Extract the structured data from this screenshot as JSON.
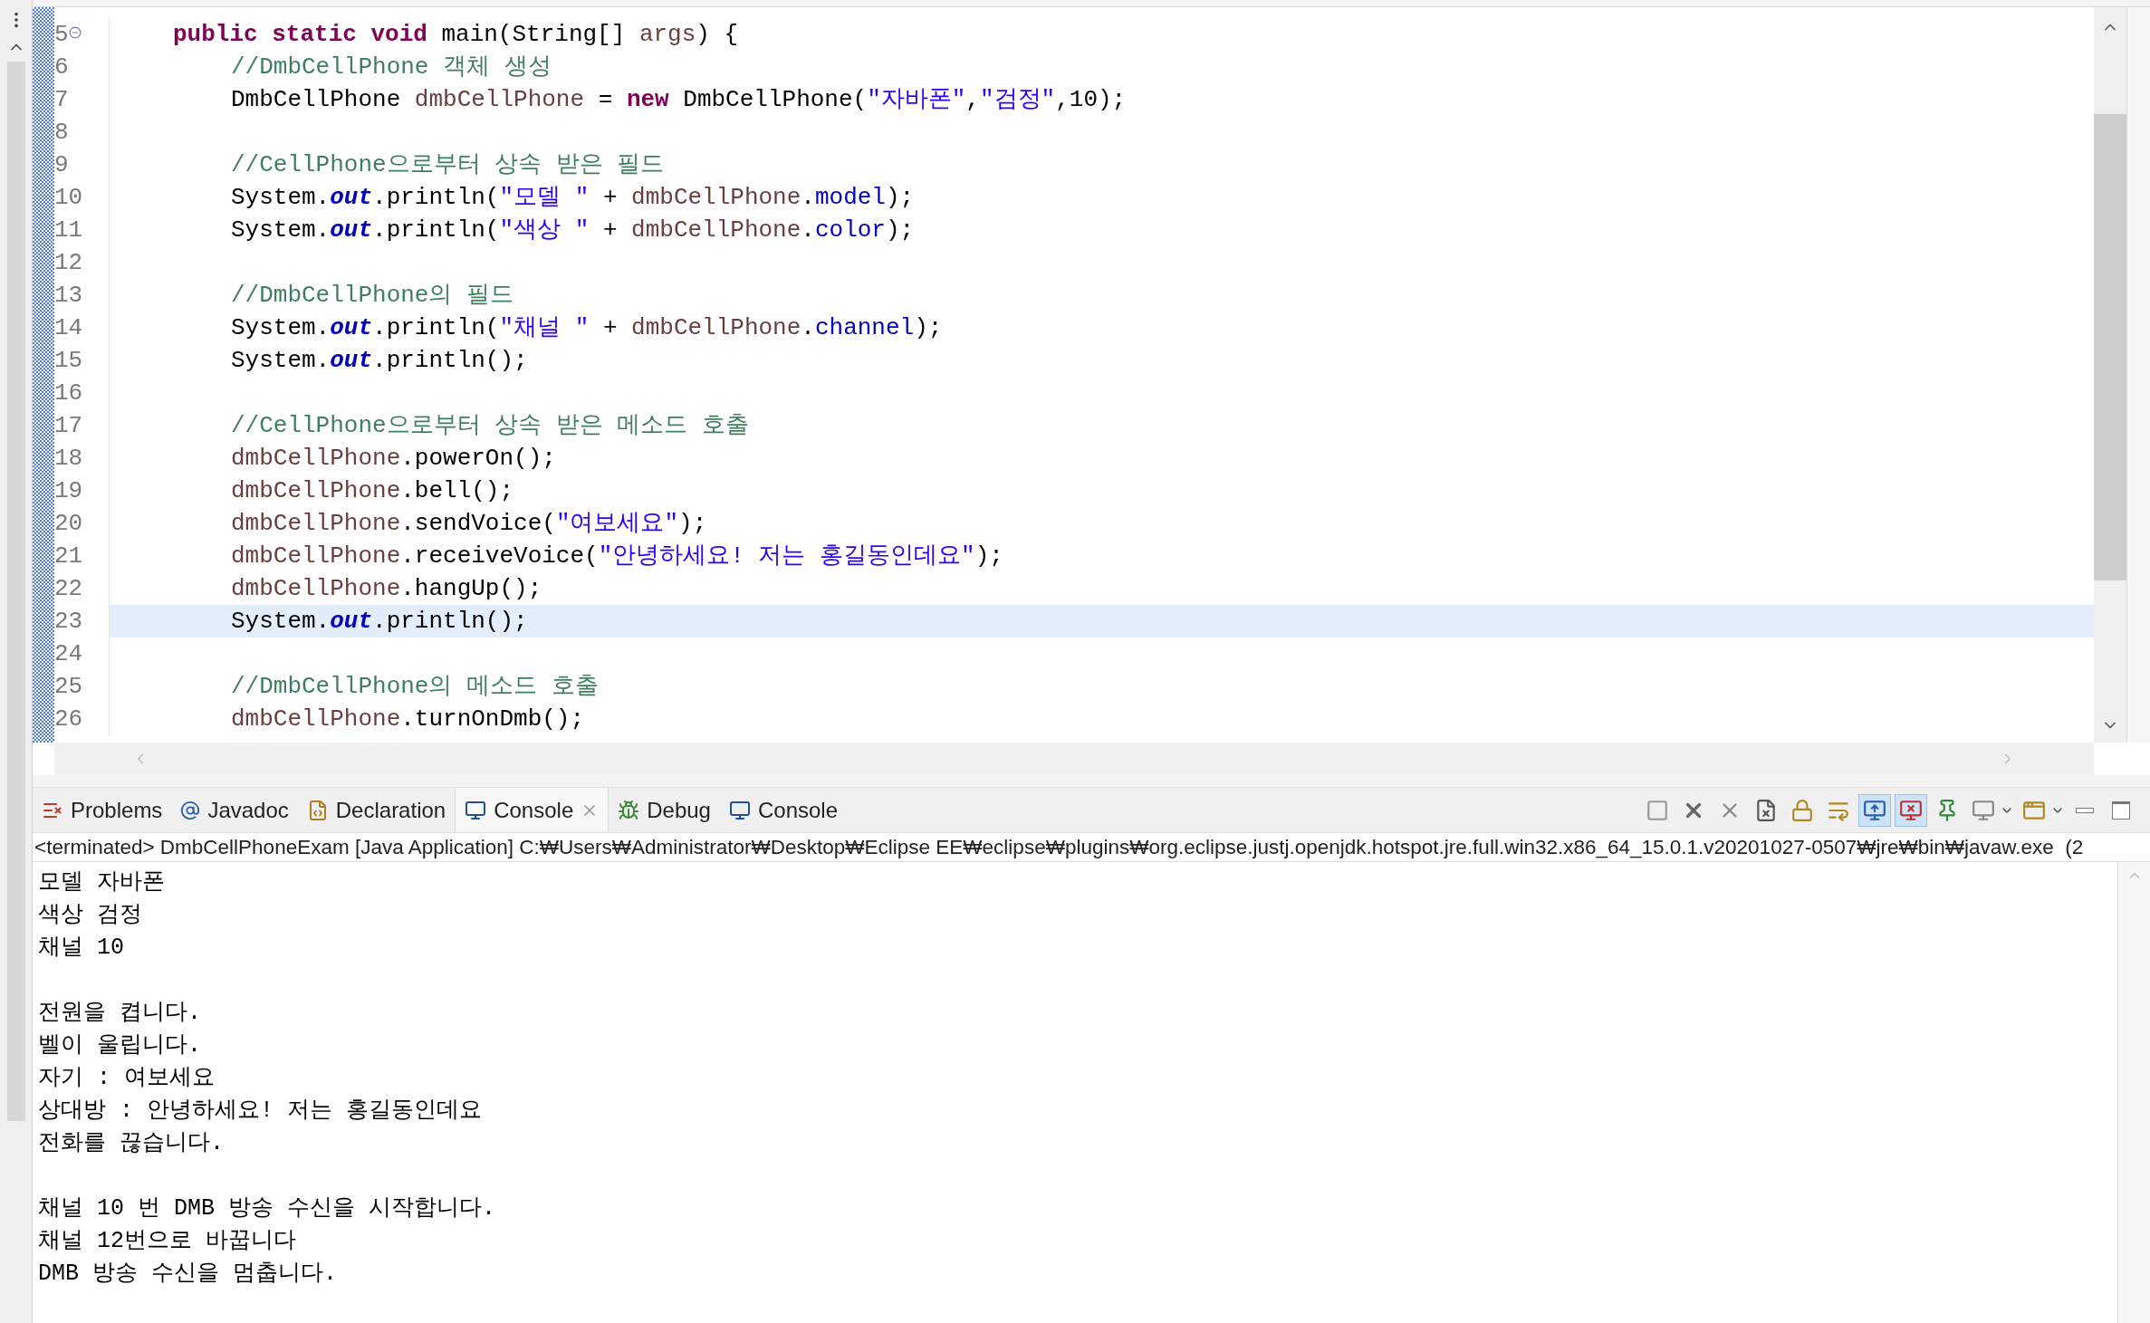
{
  "editor": {
    "lines": [
      {
        "number": "5",
        "collapsible": true,
        "current": false,
        "in_body": false,
        "tokens": [
          {
            "kind": "keyword",
            "text": "public static void"
          },
          {
            "kind": "plain",
            "text": " main(String[] "
          },
          {
            "kind": "local",
            "text": "args"
          },
          {
            "kind": "plain",
            "text": ") {"
          }
        ]
      },
      {
        "number": "6",
        "collapsible": false,
        "current": false,
        "in_body": true,
        "tokens": [
          {
            "kind": "comment",
            "text": "//DmbCellPhone 객체 생성"
          }
        ]
      },
      {
        "number": "7",
        "collapsible": false,
        "current": false,
        "in_body": true,
        "tokens": [
          {
            "kind": "plain",
            "text": "DmbCellPhone "
          },
          {
            "kind": "local",
            "text": "dmbCellPhone"
          },
          {
            "kind": "plain",
            "text": " = "
          },
          {
            "kind": "keyword",
            "text": "new"
          },
          {
            "kind": "plain",
            "text": " DmbCellPhone("
          },
          {
            "kind": "string",
            "text": "\"자바폰\""
          },
          {
            "kind": "plain",
            "text": ","
          },
          {
            "kind": "string",
            "text": "\"검정\""
          },
          {
            "kind": "plain",
            "text": ",10);"
          }
        ]
      },
      {
        "number": "8",
        "collapsible": false,
        "current": false
      },
      {
        "number": "9",
        "collapsible": false,
        "current": false,
        "in_body": true,
        "tokens": [
          {
            "kind": "comment",
            "text": "//CellPhone으로부터 상속 받은 필드"
          }
        ]
      },
      {
        "number": "10",
        "collapsible": false,
        "current": false,
        "in_body": true,
        "tokens": [
          {
            "kind": "plain",
            "text": "System."
          },
          {
            "kind": "static",
            "text": "out"
          },
          {
            "kind": "plain",
            "text": ".println("
          },
          {
            "kind": "string",
            "text": "\"모델 \""
          },
          {
            "kind": "plain",
            "text": " + "
          },
          {
            "kind": "local",
            "text": "dmbCellPhone"
          },
          {
            "kind": "plain",
            "text": "."
          },
          {
            "kind": "field",
            "text": "model"
          },
          {
            "kind": "plain",
            "text": ");"
          }
        ]
      },
      {
        "number": "11",
        "collapsible": false,
        "current": false,
        "in_body": true,
        "tokens": [
          {
            "kind": "plain",
            "text": "System."
          },
          {
            "kind": "static",
            "text": "out"
          },
          {
            "kind": "plain",
            "text": ".println("
          },
          {
            "kind": "string",
            "text": "\"색상 \""
          },
          {
            "kind": "plain",
            "text": " + "
          },
          {
            "kind": "local",
            "text": "dmbCellPhone"
          },
          {
            "kind": "plain",
            "text": "."
          },
          {
            "kind": "field",
            "text": "color"
          },
          {
            "kind": "plain",
            "text": ");"
          }
        ]
      },
      {
        "number": "12",
        "collapsible": false,
        "current": false
      },
      {
        "number": "13",
        "collapsible": false,
        "current": false,
        "in_body": true,
        "tokens": [
          {
            "kind": "comment",
            "text": "//DmbCellPhone의 필드"
          }
        ]
      },
      {
        "number": "14",
        "collapsible": false,
        "current": false,
        "in_body": true,
        "tokens": [
          {
            "kind": "plain",
            "text": "System."
          },
          {
            "kind": "static",
            "text": "out"
          },
          {
            "kind": "plain",
            "text": ".println("
          },
          {
            "kind": "string",
            "text": "\"채널 \""
          },
          {
            "kind": "plain",
            "text": " + "
          },
          {
            "kind": "local",
            "text": "dmbCellPhone"
          },
          {
            "kind": "plain",
            "text": "."
          },
          {
            "kind": "field",
            "text": "channel"
          },
          {
            "kind": "plain",
            "text": ");"
          }
        ]
      },
      {
        "number": "15",
        "collapsible": false,
        "current": false,
        "in_body": true,
        "tokens": [
          {
            "kind": "plain",
            "text": "System."
          },
          {
            "kind": "static",
            "text": "out"
          },
          {
            "kind": "plain",
            "text": ".println();"
          }
        ]
      },
      {
        "number": "16",
        "collapsible": false,
        "current": false
      },
      {
        "number": "17",
        "collapsible": false,
        "current": false,
        "in_body": true,
        "tokens": [
          {
            "kind": "comment",
            "text": "//CellPhone으로부터 상속 받은 메소드 호출"
          }
        ]
      },
      {
        "number": "18",
        "collapsible": false,
        "current": false,
        "in_body": true,
        "tokens": [
          {
            "kind": "local",
            "text": "dmbCellPhone"
          },
          {
            "kind": "plain",
            "text": ".powerOn();"
          }
        ]
      },
      {
        "number": "19",
        "collapsible": false,
        "current": false,
        "in_body": true,
        "tokens": [
          {
            "kind": "local",
            "text": "dmbCellPhone"
          },
          {
            "kind": "plain",
            "text": ".bell();"
          }
        ]
      },
      {
        "number": "20",
        "collapsible": false,
        "current": false,
        "in_body": true,
        "tokens": [
          {
            "kind": "local",
            "text": "dmbCellPhone"
          },
          {
            "kind": "plain",
            "text": ".sendVoice("
          },
          {
            "kind": "string",
            "text": "\"여보세요\""
          },
          {
            "kind": "plain",
            "text": ");"
          }
        ]
      },
      {
        "number": "21",
        "collapsible": false,
        "current": false,
        "in_body": true,
        "tokens": [
          {
            "kind": "local",
            "text": "dmbCellPhone"
          },
          {
            "kind": "plain",
            "text": ".receiveVoice("
          },
          {
            "kind": "string",
            "text": "\"안녕하세요! 저는 홍길동인데요\""
          },
          {
            "kind": "plain",
            "text": ");"
          }
        ]
      },
      {
        "number": "22",
        "collapsible": false,
        "current": false,
        "in_body": true,
        "tokens": [
          {
            "kind": "local",
            "text": "dmbCellPhone"
          },
          {
            "kind": "plain",
            "text": ".hangUp();"
          }
        ]
      },
      {
        "number": "23",
        "collapsible": false,
        "current": true,
        "in_body": true,
        "tokens": [
          {
            "kind": "plain",
            "text": "System."
          },
          {
            "kind": "static",
            "text": "out"
          },
          {
            "kind": "plain",
            "text": ".println();"
          }
        ]
      },
      {
        "number": "24",
        "collapsible": false,
        "current": false
      },
      {
        "number": "25",
        "collapsible": false,
        "current": false,
        "in_body": true,
        "tokens": [
          {
            "kind": "comment",
            "text": "//DmbCellPhone의 메소드 호출"
          }
        ]
      },
      {
        "number": "26",
        "collapsible": false,
        "current": false,
        "in_body": true,
        "tokens": [
          {
            "kind": "local",
            "text": "dmbCellPhone"
          },
          {
            "kind": "plain",
            "text": ".turnOnDmb();"
          }
        ]
      }
    ]
  },
  "panel": {
    "tabs": [
      {
        "kind": "problems",
        "label": "Problems",
        "selected": false,
        "closable": false
      },
      {
        "kind": "javadoc",
        "label": "Javadoc",
        "selected": false,
        "closable": false
      },
      {
        "kind": "declaration",
        "label": "Declaration",
        "selected": false,
        "closable": false
      },
      {
        "kind": "console",
        "label": "Console",
        "selected": true,
        "closable": true
      },
      {
        "kind": "debug",
        "label": "Debug",
        "selected": false,
        "closable": false
      },
      {
        "kind": "console",
        "label": "Console",
        "selected": false,
        "closable": false
      }
    ],
    "toolbar": [
      {
        "kind": "stop",
        "selected": false
      },
      {
        "kind": "remove",
        "selected": false
      },
      {
        "kind": "remove-all",
        "selected": false
      },
      {
        "kind": "clear",
        "selected": false
      },
      {
        "kind": "scroll-lock",
        "selected": false
      },
      {
        "kind": "word-wrap",
        "selected": false
      },
      {
        "kind": "show-out",
        "selected": true
      },
      {
        "kind": "show-err",
        "selected": true
      },
      {
        "kind": "pin",
        "selected": false
      },
      {
        "kind": "display",
        "selected": false
      },
      {
        "kind": "new-console",
        "selected": false
      },
      {
        "kind": "minimize",
        "selected": false
      },
      {
        "kind": "maximize",
        "selected": false
      }
    ],
    "process_label": "<terminated> DmbCellPhoneExam [Java Application] C:₩Users₩Administrator₩Desktop₩Eclipse EE₩eclipse₩plugins₩org.eclipse.justj.openjdk.hotspot.jre.full.win32.x86_64_15.0.1.v20201027-0507₩jre₩bin₩javaw.exe  (2",
    "console_blocks": [
      [
        "모델 자바폰",
        "색상 검정",
        "채널 10"
      ],
      [
        "전원을 켭니다.",
        "벨이 울립니다.",
        "자기 : 여보세요",
        "상대방 : 안녕하세요! 저는 홍길동인데요",
        "전화를 끊습니다."
      ],
      [
        "채널 10 번 DMB 방송 수신을 시작합니다.",
        "채널 12번으로 바꿉니다",
        "DMB 방송 수신을 멈춥니다."
      ]
    ]
  }
}
